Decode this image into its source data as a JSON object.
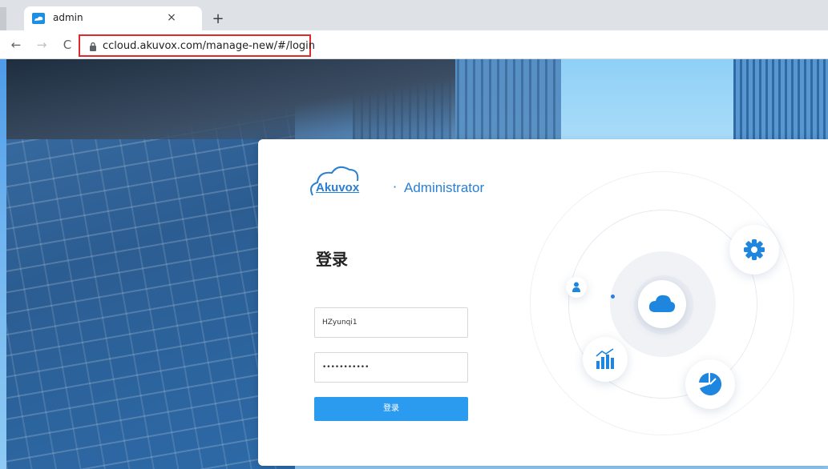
{
  "browser": {
    "tab_title": "admin",
    "tab_close": "×",
    "new_tab": "+",
    "nav": {
      "back": "←",
      "forward": "→",
      "reload": "C"
    },
    "url": "ccloud.akuvox.com/manage-new/#/login"
  },
  "card": {
    "brand": "Akuvox",
    "separator": "·",
    "product": "Administrator",
    "login_title": "登录",
    "username_value": "HZyunqi1",
    "password_value": "•••••••••••",
    "login_button": "登录"
  },
  "colors": {
    "accent": "#2b9bf0",
    "brand": "#2a7fd4",
    "url_highlight": "#e02a2a"
  },
  "icons": [
    "cloud-icon",
    "gear-icon",
    "user-icon",
    "chart-icon",
    "pie-chart-icon",
    "lock-icon"
  ]
}
